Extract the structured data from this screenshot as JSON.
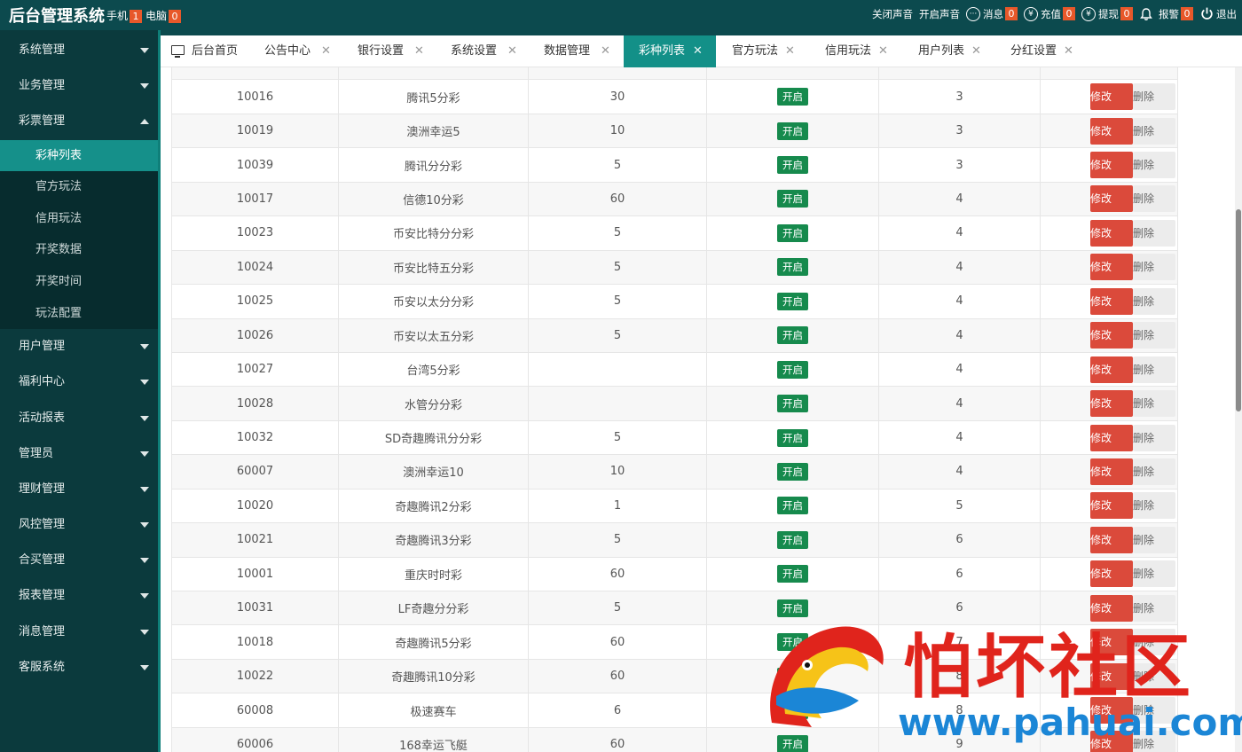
{
  "header": {
    "title": "后台管理系统",
    "phone_label": "手机",
    "phone_count": "1",
    "pc_label": "电脑",
    "pc_count": "0",
    "mute_label": "关闭声音",
    "unmute_label": "开启声音",
    "message_label": "消息",
    "message_count": "0",
    "recharge_label": "充值",
    "recharge_count": "0",
    "withdraw_label": "提现",
    "withdraw_count": "0",
    "alarm_label": "报警",
    "alarm_count": "0",
    "logout_label": "退出"
  },
  "sidebar": {
    "items": [
      {
        "label": "系统管理"
      },
      {
        "label": "业务管理"
      },
      {
        "label": "彩票管理",
        "subitems": [
          "彩种列表",
          "官方玩法",
          "信用玩法",
          "开奖数据",
          "开奖时间",
          "玩法配置"
        ]
      },
      {
        "label": "用户管理"
      },
      {
        "label": "福利中心"
      },
      {
        "label": "活动报表"
      },
      {
        "label": "管理员"
      },
      {
        "label": "理财管理"
      },
      {
        "label": "风控管理"
      },
      {
        "label": "合买管理"
      },
      {
        "label": "报表管理"
      },
      {
        "label": "消息管理"
      },
      {
        "label": "客服系统"
      }
    ]
  },
  "tabs": [
    "后台首页",
    "公告中心",
    "银行设置",
    "系统设置",
    "数据管理",
    "彩种列表",
    "官方玩法",
    "信用玩法",
    "用户列表",
    "分红设置"
  ],
  "active_tab": "彩种列表",
  "table": {
    "status_label": "开启",
    "edit_label": "修改",
    "delete_label": "删除",
    "rows": [
      {
        "id": "10016",
        "name": "腾讯5分彩",
        "value": "30",
        "order": "3"
      },
      {
        "id": "10019",
        "name": "澳洲幸运5",
        "value": "10",
        "order": "3"
      },
      {
        "id": "10039",
        "name": "腾讯分分彩",
        "value": "5",
        "order": "3"
      },
      {
        "id": "10017",
        "name": "信德10分彩",
        "value": "60",
        "order": "4"
      },
      {
        "id": "10023",
        "name": "币安比特分分彩",
        "value": "5",
        "order": "4"
      },
      {
        "id": "10024",
        "name": "币安比特五分彩",
        "value": "5",
        "order": "4"
      },
      {
        "id": "10025",
        "name": "币安以太分分彩",
        "value": "5",
        "order": "4"
      },
      {
        "id": "10026",
        "name": "币安以太五分彩",
        "value": "5",
        "order": "4"
      },
      {
        "id": "10027",
        "name": "台湾5分彩",
        "value": "",
        "order": "4"
      },
      {
        "id": "10028",
        "name": "水管分分彩",
        "value": "",
        "order": "4"
      },
      {
        "id": "10032",
        "name": "SD奇趣腾讯分分彩",
        "value": "5",
        "order": "4"
      },
      {
        "id": "60007",
        "name": "澳洲幸运10",
        "value": "10",
        "order": "4"
      },
      {
        "id": "10020",
        "name": "奇趣腾讯2分彩",
        "value": "1",
        "order": "5"
      },
      {
        "id": "10021",
        "name": "奇趣腾讯3分彩",
        "value": "5",
        "order": "6"
      },
      {
        "id": "10001",
        "name": "重庆时时彩",
        "value": "60",
        "order": "6"
      },
      {
        "id": "10031",
        "name": "LF奇趣分分彩",
        "value": "5",
        "order": "6"
      },
      {
        "id": "10018",
        "name": "奇趣腾讯5分彩",
        "value": "60",
        "order": "7"
      },
      {
        "id": "10022",
        "name": "奇趣腾讯10分彩",
        "value": "60",
        "order": "8"
      },
      {
        "id": "60008",
        "name": "极速赛车",
        "value": "6",
        "order": "8"
      },
      {
        "id": "60006",
        "name": "168幸运飞艇",
        "value": "60",
        "order": "9"
      }
    ]
  },
  "watermark": {
    "title": "怕坏社区",
    "url": "www.pahuai.com"
  },
  "colors": {
    "header_bg": "#0c4a4e",
    "sidebar_bg": "#0b3a3d",
    "accent": "#139088",
    "status_green": "#168a4d",
    "edit_red": "#db4a3b",
    "badge_orange": "#e8582a"
  }
}
